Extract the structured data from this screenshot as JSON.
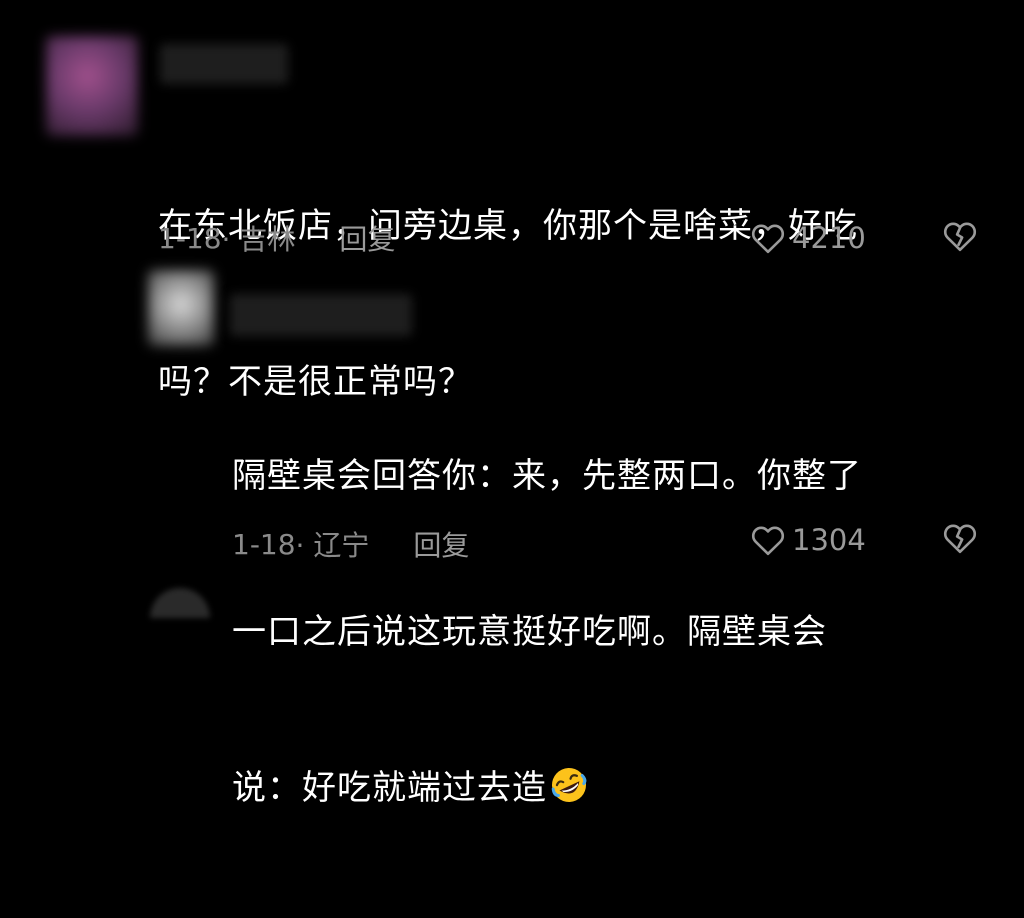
{
  "comments": [
    {
      "text_line1": "在东北饭店，问旁边桌，你那个是啥菜，好吃",
      "text_line2": "吗？不是很正常吗？",
      "date": "1-18",
      "location": "· 吉林",
      "reply_label": "回复",
      "likes": "4210"
    },
    {
      "text_line1": "隔壁桌会回答你：来，先整两口。你整了",
      "text_line2": "一口之后说这玩意挺好吃啊。隔壁桌会",
      "text_line3": "说：好吃就端过去造",
      "emoji": "rolling-on-floor-laughing",
      "date": "1-18",
      "location": "· 辽宁",
      "reply_label": "回复",
      "likes": "1304"
    }
  ],
  "colors": {
    "background": "#000000",
    "text": "#ffffff",
    "meta": "#8a8a8a"
  }
}
